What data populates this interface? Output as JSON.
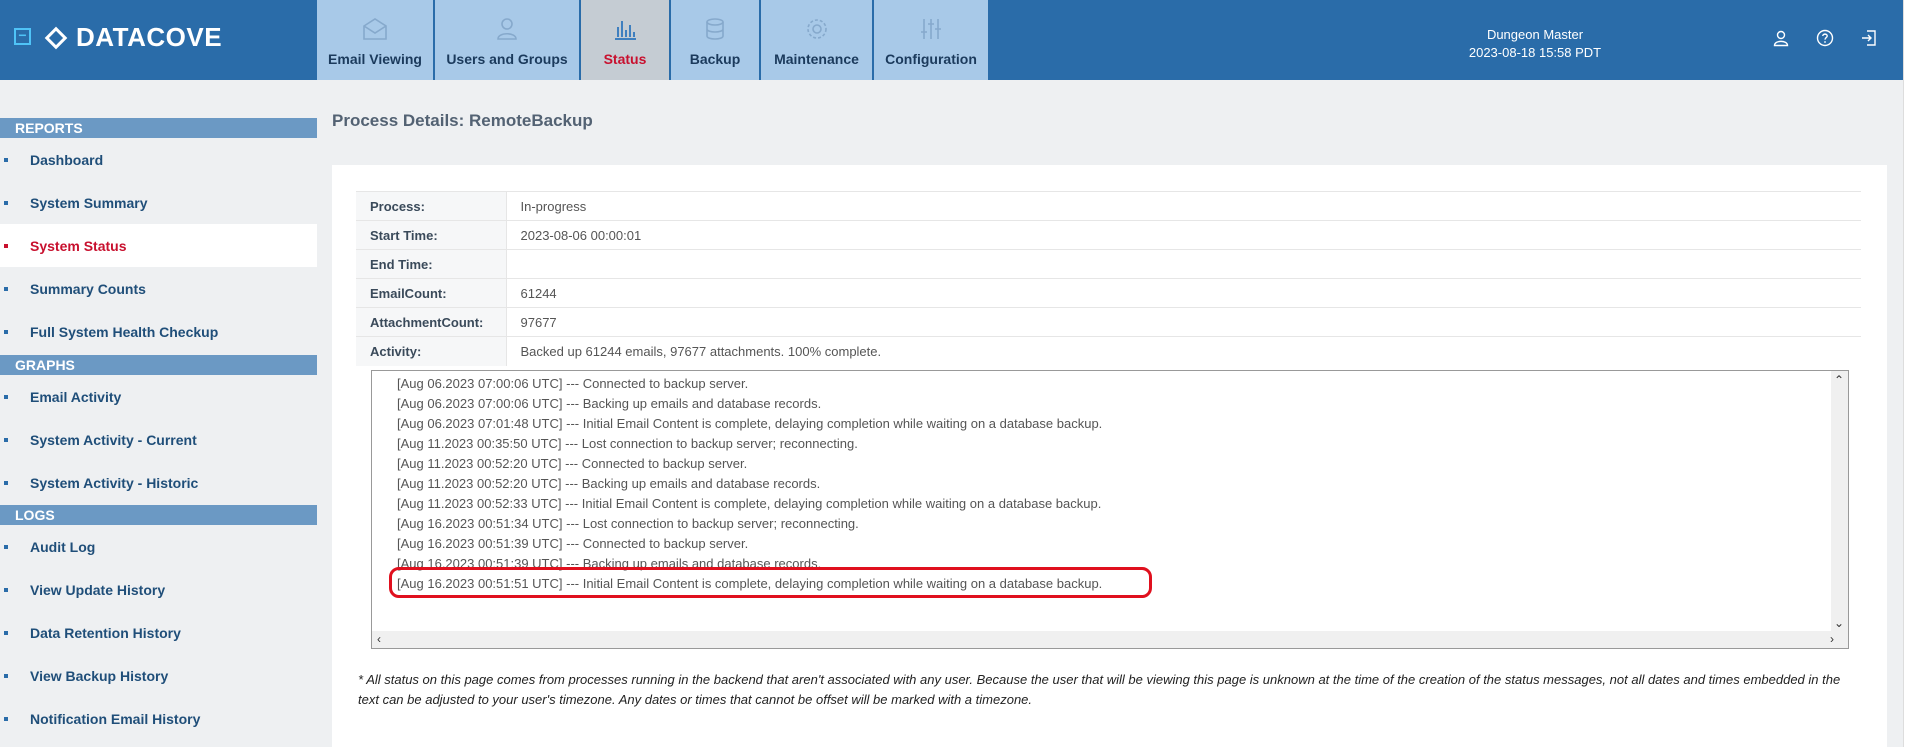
{
  "header": {
    "brand": "DATACOVE",
    "user_name": "Dungeon Master",
    "datetime": "2023-08-18 15:58 PDT",
    "tabs": [
      {
        "label": "Email Viewing",
        "icon": "envelope-icon"
      },
      {
        "label": "Users and Groups",
        "icon": "users-icon"
      },
      {
        "label": "Status",
        "icon": "bar-chart-icon"
      },
      {
        "label": "Backup",
        "icon": "database-icon"
      },
      {
        "label": "Maintenance",
        "icon": "gear-icon"
      },
      {
        "label": "Configuration",
        "icon": "sliders-icon"
      }
    ],
    "icons": [
      "user-icon",
      "help-icon",
      "logout-icon"
    ]
  },
  "sidebar": {
    "sections": [
      {
        "title": "REPORTS",
        "items": [
          "Dashboard",
          "System Summary",
          "System Status",
          "Summary Counts",
          "Full System Health Checkup"
        ]
      },
      {
        "title": "GRAPHS",
        "items": [
          "Email Activity",
          "System Activity - Current",
          "System Activity - Historic"
        ]
      },
      {
        "title": "LOGS",
        "items": [
          "Audit Log",
          "View Update History",
          "Data Retention History",
          "View Backup History",
          "Notification Email History"
        ]
      }
    ],
    "active_item": "System Status"
  },
  "main": {
    "title": "Process Details: RemoteBackup",
    "details": [
      {
        "key": "Process:",
        "value": "In-progress"
      },
      {
        "key": "Start Time:",
        "value": "2023-08-06 00:00:01"
      },
      {
        "key": "End Time:",
        "value": ""
      },
      {
        "key": "EmailCount:",
        "value": "61244"
      },
      {
        "key": "AttachmentCount:",
        "value": "97677"
      },
      {
        "key": "Activity:",
        "value": "Backed up 61244 emails, 97677 attachments. 100% complete."
      }
    ],
    "log_lines": [
      "[Aug 06.2023 07:00:06 UTC] --- Connected to backup server.",
      "[Aug 06.2023 07:00:06 UTC] --- Backing up emails and database records.",
      "[Aug 06.2023 07:01:48 UTC] --- Initial Email Content is complete, delaying completion while waiting on a database backup.",
      "[Aug 11.2023 00:35:50 UTC] --- Lost connection to backup server; reconnecting.",
      "[Aug 11.2023 00:52:20 UTC] --- Connected to backup server.",
      "[Aug 11.2023 00:52:20 UTC] --- Backing up emails and database records.",
      "[Aug 11.2023 00:52:33 UTC] --- Initial Email Content is complete, delaying completion while waiting on a database backup.",
      "[Aug 16.2023 00:51:34 UTC] --- Lost connection to backup server; reconnecting.",
      "[Aug 16.2023 00:51:39 UTC] --- Connected to backup server.",
      "[Aug 16.2023 00:51:39 UTC] --- Backing up emails and database records.",
      "[Aug 16.2023 00:51:51 UTC] --- Initial Email Content is complete, delaying completion while waiting on a database backup."
    ],
    "footnote": "* All status on this page comes from processes running in the backend that aren't associated with any user. Because the user that will be viewing this page is unknown at the time of the creation of the status messages, not all dates and times embedded in the text can be adjusted to your user's timezone. Any dates or times that cannot be offset will be marked with a timezone."
  },
  "colors": {
    "header_bg": "#2a6ca9",
    "tab_bg": "#a8c9e8",
    "active_tab_bg": "#c5ccd3",
    "active_red": "#c8102e",
    "section_bg": "#6b99c4",
    "highlight": "#e0101e"
  }
}
